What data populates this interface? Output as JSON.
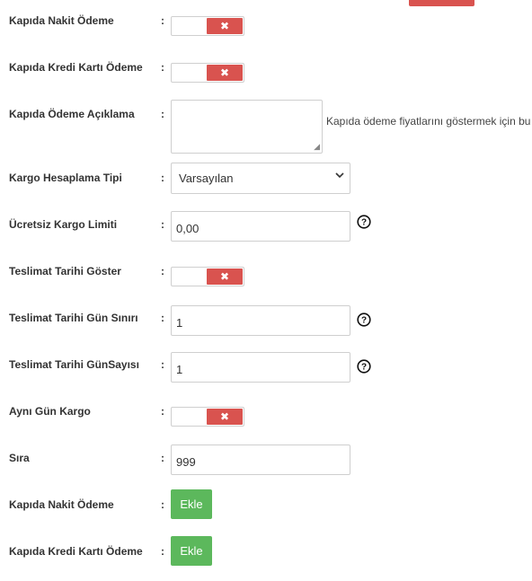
{
  "colors": {
    "danger": "#d9534f",
    "success": "#5cb85c",
    "border": "#cfcfcf"
  },
  "colon": ":",
  "rows": {
    "kapida_nakit": {
      "label": "Kapıda Nakit Ödeme",
      "toggle_state": "off",
      "toggle_icon": "✖"
    },
    "kapida_kredi": {
      "label": "Kapıda Kredi Kartı Ödeme",
      "toggle_state": "off",
      "toggle_icon": "✖"
    },
    "kapida_aciklama": {
      "label": "Kapıda Ödeme Açıklama",
      "value": "",
      "hint": "Kapıda ödeme fiyatlarını göstermek için bu"
    },
    "kargo_tipi": {
      "label": "Kargo Hesaplama Tipi",
      "selected": "Varsayılan"
    },
    "ucretsiz_limit": {
      "label": "Ücretsiz Kargo Limiti",
      "value": "0,00",
      "help_icon": "question-circle-icon"
    },
    "teslimat_goster": {
      "label": "Teslimat Tarihi Göster",
      "toggle_state": "off",
      "toggle_icon": "✖"
    },
    "teslimat_gun_siniri": {
      "label": "Teslimat Tarihi Gün Sınırı",
      "value": "1",
      "help_icon": "question-circle-icon"
    },
    "teslimat_gun_sayisi": {
      "label": "Teslimat Tarihi GünSayısı",
      "value": "1",
      "help_icon": "question-circle-icon"
    },
    "ayni_gun": {
      "label": "Aynı Gün Kargo",
      "toggle_state": "off",
      "toggle_icon": "✖"
    },
    "sira": {
      "label": "Sıra",
      "value": "999"
    },
    "ekle_nakit": {
      "label": "Kapıda Nakit Ödeme",
      "button": "Ekle"
    },
    "ekle_kredi": {
      "label": "Kapıda Kredi Kartı Ödeme",
      "button": "Ekle"
    }
  }
}
